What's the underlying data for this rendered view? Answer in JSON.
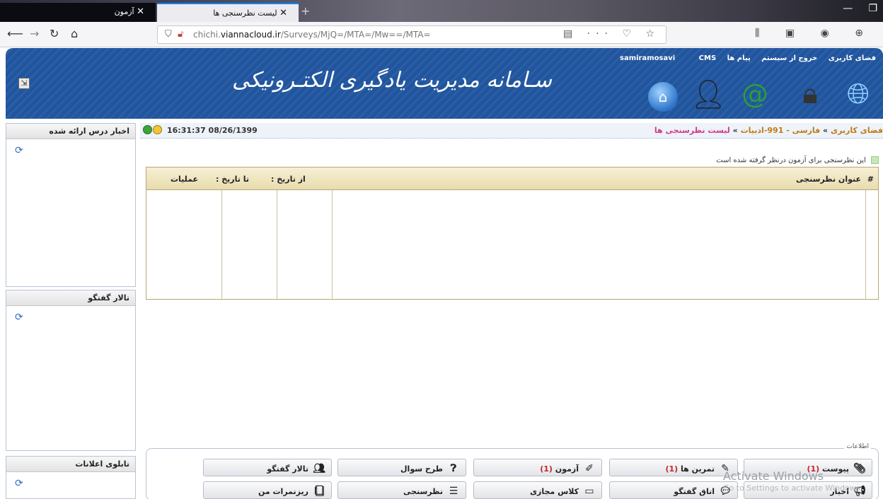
{
  "browser": {
    "tabs": [
      {
        "title": "آزمون"
      },
      {
        "title": "لیست نظرسنجی ها"
      }
    ],
    "url": {
      "prefix": "chichi.",
      "domain": "viannacloud.ir",
      "path": "/Surveys/MjQ=/MTA=/Mw==/MTA="
    }
  },
  "header": {
    "links": [
      "فضای کاربری",
      "خروج از سیستم",
      "پیام ها",
      "samiramosavi",
      "CMS"
    ],
    "logo_text": "سـامانه مدیریت یادگیری الکتـرونیکی"
  },
  "sidebar": {
    "boxes": [
      {
        "title": "اخبار درس ارائه شده"
      },
      {
        "title": "تالار گفتگو"
      },
      {
        "title": "تابلوی اعلانات"
      }
    ]
  },
  "main": {
    "datetime": "16:31:37 08/26/1399",
    "breadcrumb": [
      "فضای کاربری",
      "فارسی - 991-ادبیات",
      "لیست نظرسنجی ها"
    ],
    "breadcrumb_sep": "»",
    "legend_text": "این نظرسنجی برای آزمون درنظر گرفته شده است",
    "table": {
      "headers": [
        "#",
        "عنوان نظرسنجی",
        "از تاریخ :",
        "تا تاریخ :",
        "عملیات"
      ]
    }
  },
  "bottom": {
    "caption": "اطلاعات",
    "buttons_row1": [
      {
        "label": "پیوست",
        "count": "(1)",
        "icon": "paperclip-icon"
      },
      {
        "label": "تمرین ها",
        "count": "(1)",
        "icon": "pencil-icon"
      },
      {
        "label": "آزمون",
        "count": "(1)",
        "icon": "pen-ruler-icon"
      },
      {
        "label": "طرح سوال",
        "count": "",
        "icon": "question-icon"
      },
      {
        "label": "تالار گفتگو",
        "count": "",
        "icon": "people-icon"
      }
    ],
    "buttons_row2": [
      {
        "label": "اخبار",
        "icon": "megaphone-icon"
      },
      {
        "label": "اتاق گفتگو",
        "icon": "chat-icon"
      },
      {
        "label": "کلاس مجازی",
        "icon": "board-icon"
      },
      {
        "label": "نظرسنجی",
        "icon": "list-icon"
      },
      {
        "label": "ریزنمرات من",
        "icon": "notebook-icon"
      }
    ]
  },
  "overlay": {
    "line1": "Activate Windows",
    "line2": "Go to Settings to activate Windows"
  },
  "colors": {
    "header_blue": "#23559c",
    "count_red": "#c0272d",
    "crumb_orange": "#c07a14",
    "crumb_current": "#d33a8a"
  }
}
